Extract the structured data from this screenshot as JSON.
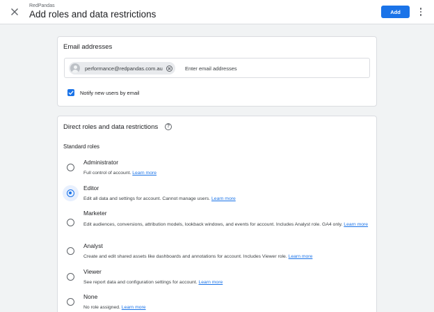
{
  "header": {
    "breadcrumb": "RedPandas",
    "title": "Add roles and data restrictions",
    "add_label": "Add",
    "close_icon": "close-icon",
    "more_icon": "more-vert-icon"
  },
  "email_section": {
    "title": "Email addresses",
    "chip_email": "performance@redpandas.com.au",
    "input_placeholder": "Enter email addresses",
    "notify_label": "Notify new users by email",
    "notify_checked": true
  },
  "roles_section": {
    "title": "Direct roles and data restrictions",
    "help_icon": "help-icon",
    "subheading": "Standard roles",
    "selected": "Editor",
    "roles": [
      {
        "name": "Administrator",
        "desc": "Full control of account.",
        "desc2": "",
        "link": "Learn more"
      },
      {
        "name": "Editor",
        "desc": "Edit all data and settings for account. Cannot manage users.",
        "desc2": "",
        "link": "Learn more"
      },
      {
        "name": "Marketer",
        "desc": "Edit audiences, conversions, attribution models, lookback windows, and events for account. Includes Analyst role. GA4 only.",
        "desc2": "",
        "link": "Learn more"
      },
      {
        "name": "Analyst",
        "desc": "Create and edit shared assets like dashboards and annotations for account. Includes Viewer role.",
        "desc2": "",
        "link": "Learn more"
      },
      {
        "name": "Viewer",
        "desc": "See report data and configuration settings for account.",
        "desc2": "",
        "link": "Learn more"
      },
      {
        "name": "None",
        "desc": "No role assigned.",
        "desc2": "",
        "link": "Learn more"
      }
    ]
  },
  "colors": {
    "accent": "#1a73e8",
    "background": "#f1f3f4"
  }
}
